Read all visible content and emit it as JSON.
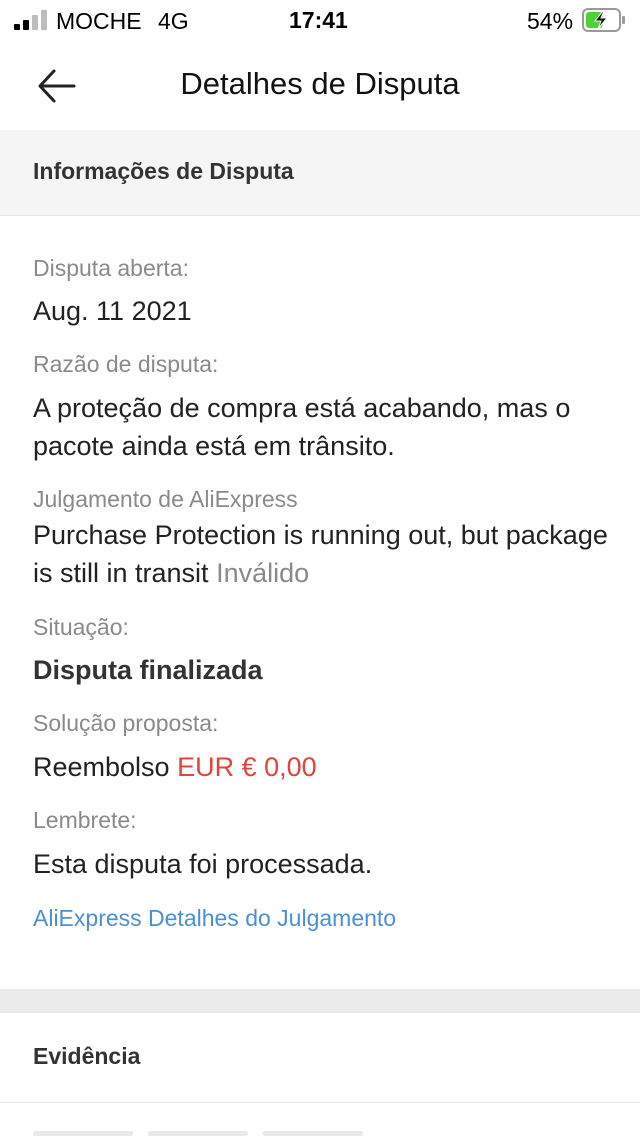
{
  "status_bar": {
    "carrier": "MOCHE",
    "network": "4G",
    "time": "17:41",
    "battery_percent": "54%",
    "battery_level": 0.54
  },
  "nav": {
    "back_icon": "arrow-left-icon",
    "title": "Detalhes de Disputa"
  },
  "dispute_info": {
    "header": "Informações de Disputa",
    "opened_label": "Disputa aberta:",
    "opened_value": "Aug. 11 2021",
    "reason_label": "Razão de disputa:",
    "reason_value": "A proteção de compra está acabando, mas o pacote ainda está em trânsito.",
    "judgment_label": "Julgamento de AliExpress",
    "judgment_value": "Purchase Protection is running out, but package is still in transit",
    "judgment_status": "Inválido",
    "situation_label": "Situação:",
    "situation_value": "Disputa finalizada",
    "solution_label": "Solução proposta:",
    "solution_type": "Reembolso",
    "solution_amount": "EUR € 0,00",
    "reminder_label": "Lembrete:",
    "reminder_value": "Esta disputa foi processada.",
    "details_link": "AliExpress Detalhes do Julgamento"
  },
  "evidence": {
    "header": "Evidência"
  },
  "colors": {
    "accent_red": "#e0443a",
    "link_blue": "#4a90d6",
    "battery_green": "#4cd137"
  }
}
